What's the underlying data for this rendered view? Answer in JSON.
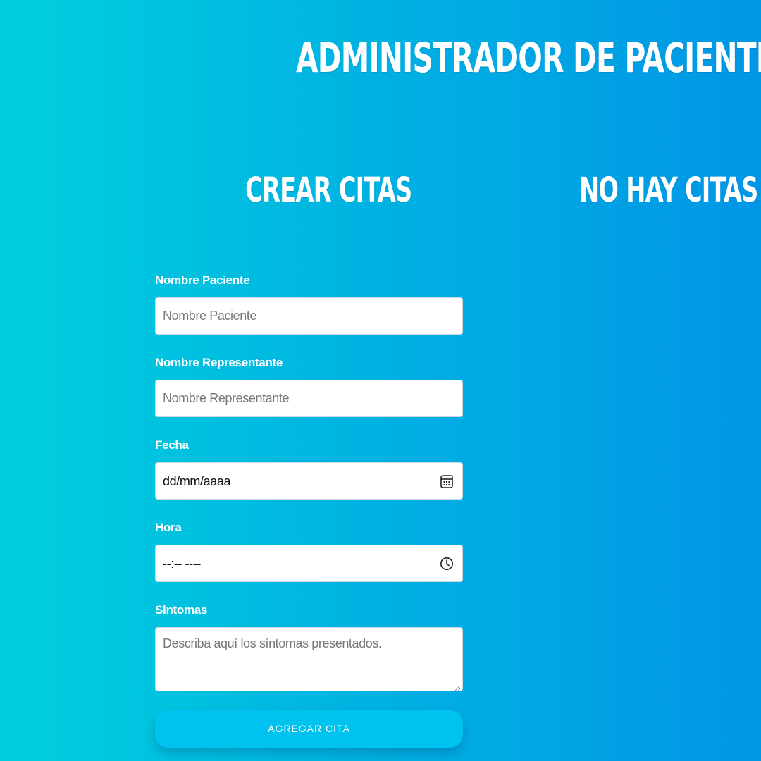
{
  "header": {
    "title": "ADMINISTRADOR DE PACIENTES"
  },
  "create_section": {
    "title": "CREAR CITAS"
  },
  "appointments_section": {
    "empty_title": "NO HAY CITAS"
  },
  "form": {
    "patient_name": {
      "label": "Nombre Paciente",
      "placeholder": "Nombre Paciente"
    },
    "representative_name": {
      "label": "Nombre Representante",
      "placeholder": "Nombre Representante"
    },
    "date": {
      "label": "Fecha",
      "display_value": "dd/mm/aaaa",
      "icon": "calendar-icon"
    },
    "time": {
      "label": "Hora",
      "display_value": "--:-- ----",
      "icon": "clock-icon"
    },
    "symptoms": {
      "label": "Sintomas",
      "placeholder": "Describa aquí los síntomas presentados."
    },
    "submit_label": "AGREGAR CITA"
  },
  "colors": {
    "background_start": "#00d0dd",
    "background_end": "#0096e6",
    "button": "#00c2ee",
    "text": "#ffffff"
  }
}
